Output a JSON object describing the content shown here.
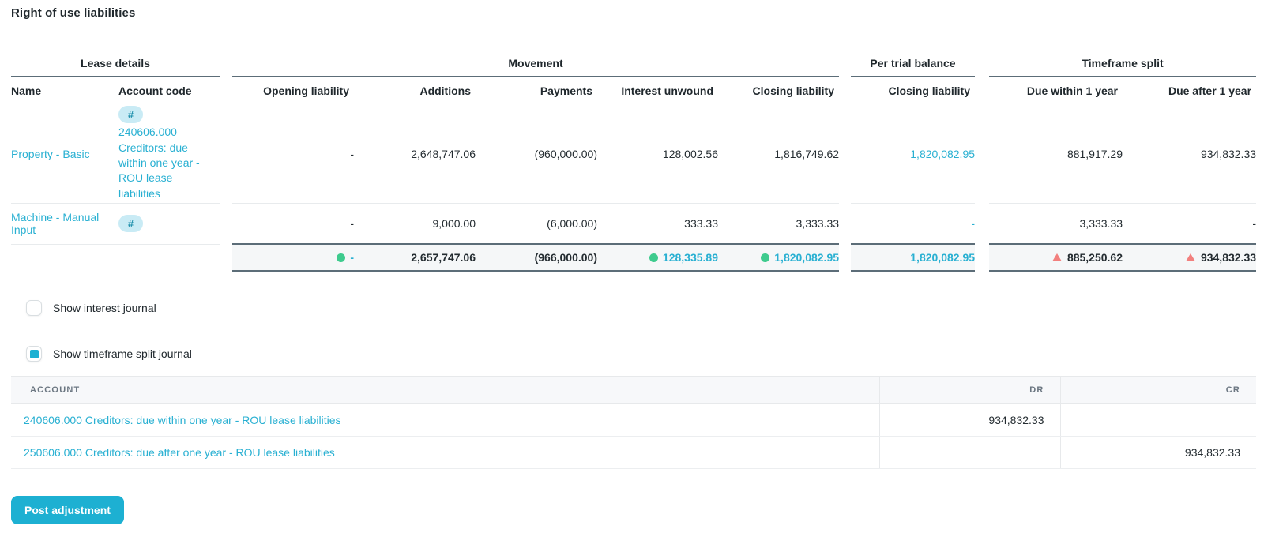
{
  "title": "Right of use liabilities",
  "icons": {
    "hash": "#"
  },
  "colors": {
    "link_teal": "#29b0d2",
    "accent_cyan": "#1db0d2",
    "positive_green": "#3ecb8e",
    "warning_red": "#f2807e",
    "rule_dark": "#5c6d78"
  },
  "lease_table": {
    "groups": {
      "lease_details": "Lease details",
      "movement": "Movement",
      "per_trial_balance": "Per trial balance",
      "timeframe_split": "Timeframe split"
    },
    "columns": {
      "name": "Name",
      "account_code": "Account code",
      "opening_liability": "Opening liability",
      "additions": "Additions",
      "payments": "Payments",
      "interest_unwound": "Interest unwound",
      "closing_liability": "Closing liability",
      "tb_closing_liability": "Closing liability",
      "due_within_1_year": "Due within 1 year",
      "due_after_1_year": "Due after 1 year"
    },
    "rows": [
      {
        "name": "Property - Basic",
        "account_code": "240606.000 Creditors: due within one year - ROU lease liabilities",
        "opening_liability": "-",
        "additions": "2,648,747.06",
        "payments": "(960,000.00)",
        "interest_unwound": "128,002.56",
        "closing_liability": "1,816,749.62",
        "tb_closing_liability": "1,820,082.95",
        "due_within_1_year": "881,917.29",
        "due_after_1_year": "934,832.33"
      },
      {
        "name": "Machine - Manual Input",
        "account_code": "",
        "opening_liability": "-",
        "additions": "9,000.00",
        "payments": "(6,000.00)",
        "interest_unwound": "333.33",
        "closing_liability": "3,333.33",
        "tb_closing_liability": "-",
        "due_within_1_year": "3,333.33",
        "due_after_1_year": "-"
      }
    ],
    "totals": {
      "opening_liability": "-",
      "additions": "2,657,747.06",
      "payments": "(966,000.00)",
      "interest_unwound": "128,335.89",
      "closing_liability": "1,820,082.95",
      "tb_closing_liability": "1,820,082.95",
      "due_within_1_year": "885,250.62",
      "due_after_1_year": "934,832.33"
    }
  },
  "controls": {
    "show_interest_journal": {
      "label": "Show interest journal",
      "checked": false
    },
    "show_timeframe_split_journal": {
      "label": "Show timeframe split journal",
      "checked": true
    }
  },
  "journal_table": {
    "columns": {
      "account": "ACCOUNT",
      "dr": "DR",
      "cr": "CR"
    },
    "rows": [
      {
        "account": "240606.000 Creditors: due within one year - ROU lease liabilities",
        "dr": "934,832.33",
        "cr": ""
      },
      {
        "account": "250606.000 Creditors: due after one year - ROU lease liabilities",
        "dr": "",
        "cr": "934,832.33"
      }
    ]
  },
  "post_button": "Post adjustment"
}
